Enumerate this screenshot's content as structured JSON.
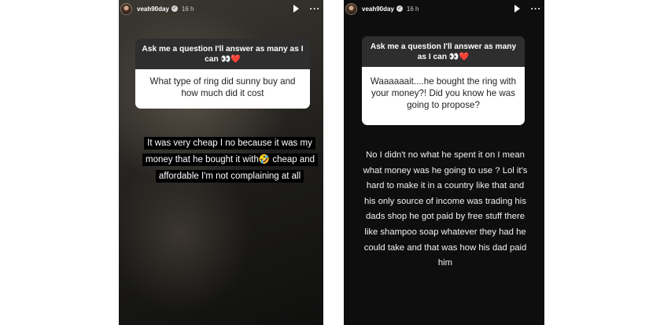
{
  "story_left": {
    "username": "veah90day",
    "timestamp": "16 h",
    "question_prompt": "Ask me a question I'll answer as many as I can",
    "prompt_emojis": "👀",
    "prompt_heart": "❤️",
    "question": "What type of ring did sunny buy and how much did it cost",
    "answer": "It was very cheap I no because it was my money that he bought it with🤣 cheap and affordable I'm not complaining at all"
  },
  "story_right": {
    "username": "veah90day",
    "timestamp": "16 h",
    "question_prompt": "Ask me a question I'll answer as many as I can",
    "prompt_emojis": "👀",
    "prompt_heart": "❤️",
    "question": "Waaaaaait....he bought the ring with your money?! Did you know he was going to propose?",
    "answer": "No I didn't no what he spent it on I mean what money was he going to use ? Lol it's hard to make it in a country like that and his only source of income was trading his dads shop he got paid by free stuff there like shampoo soap  whatever they had he could take and that was how his dad paid him"
  }
}
